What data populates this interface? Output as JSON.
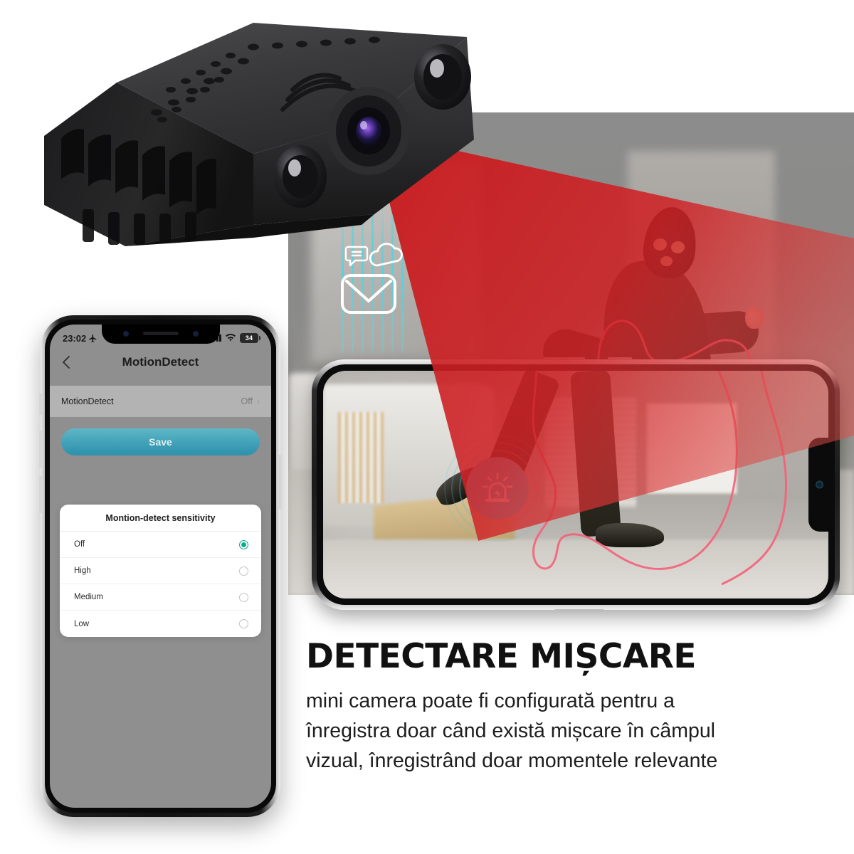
{
  "product_banner": {
    "headline": "DETECTARE MIȘCARE",
    "body_lines": [
      "mini camera poate fi configurată pentru a",
      "înregistra doar când există mișcare în câmpul",
      "vizual, înregistrând doar momentele relevante"
    ]
  },
  "phone_app": {
    "status_bar": {
      "time": "23:02",
      "airplane_icon": "airplane-icon",
      "signal_icon": "signal-bars-icon",
      "wifi_icon": "wifi-icon",
      "battery_level": "34"
    },
    "nav": {
      "back_icon": "chevron-left-icon",
      "title": "MotionDetect"
    },
    "setting_row": {
      "label": "MotionDetect",
      "value": "Off",
      "chevron_icon": "chevron-right-icon"
    },
    "save_button": {
      "label": "Save",
      "color": "#3e9fb6"
    },
    "sensitivity_modal": {
      "title": "Montion-detect sensitivity",
      "selected": "Off",
      "accent_color": "#0eac8e",
      "options": [
        {
          "label": "Off",
          "selected": true
        },
        {
          "label": "High",
          "selected": false
        },
        {
          "label": "Medium",
          "selected": false
        },
        {
          "label": "Low",
          "selected": false
        }
      ]
    }
  },
  "scene": {
    "camera_device": {
      "name": "mini-spy-camera",
      "body_color": "#1f1f21",
      "lens_color": "#6b43b0",
      "detection_cone_color": "#cf1f22"
    },
    "alarm_badge": {
      "icon": "siren-alarm-icon",
      "circle_color": "#5bc4dc",
      "ring_color": "#46c4dc"
    },
    "notification_icons": [
      "chat-bubble-icon",
      "cloud-icon",
      "envelope-icon"
    ],
    "motion_outline_color": "#f4607a",
    "beam_color": "#46d7e6"
  }
}
